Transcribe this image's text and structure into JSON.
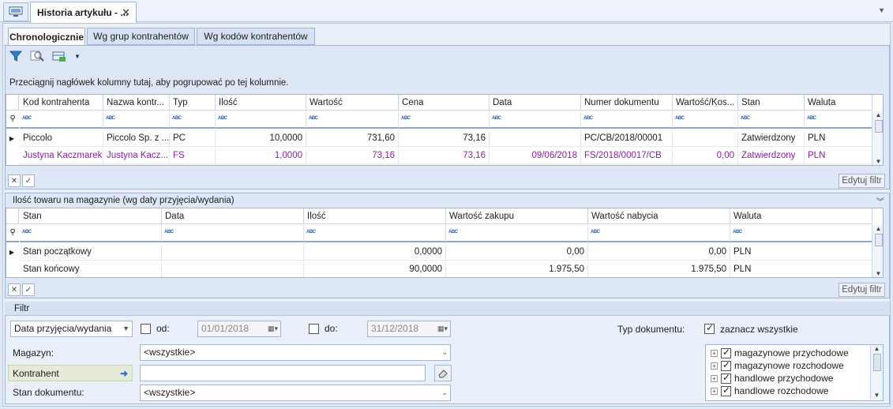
{
  "window": {
    "tab_title": "Historia artykułu - ...",
    "close": "✕",
    "menu_arrow": "▼"
  },
  "tabs": [
    {
      "label": "Chronologicznie"
    },
    {
      "label": "Wg grup kontrahentów"
    },
    {
      "label": "Wg kodów kontrahentów"
    }
  ],
  "group_hint": "Przeciągnij nagłówek kolumny tutaj, aby pogrupować po tej kolumnie.",
  "filter_row_marker": "ABC",
  "grid1": {
    "headers": [
      "Kod kontrahenta",
      "Nazwa kontr...",
      "Typ",
      "Ilość",
      "Wartość",
      "Cena",
      "Data",
      "Numer dokumentu",
      "Wartość/Kos...",
      "Stan",
      "Waluta"
    ],
    "rows": [
      [
        "Piccolo",
        "Piccolo Sp. z ...",
        "PC",
        "10,0000",
        "731,60",
        "73,16",
        "",
        "PC/CB/2018/00001",
        "",
        "Zatwierdzony",
        "PLN"
      ],
      [
        "Justyna Kaczmarek",
        "Justyna Kacz...",
        "FS",
        "1,0000",
        "73,16",
        "73,16",
        "09/06/2018",
        "FS/2018/00017/CB",
        "0,00",
        "Zatwierdzony",
        "PLN"
      ]
    ],
    "edit_filter": "Edytuj filtr"
  },
  "section2_title": "Ilość towaru na magazynie (wg daty przyjęcia/wydania)",
  "grid2": {
    "headers": [
      "Stan",
      "Data",
      "Ilość",
      "Wartość zakupu",
      "Wartość nabycia",
      "Waluta"
    ],
    "rows": [
      [
        "Stan początkowy",
        "",
        "0,0000",
        "0,00",
        "0,00",
        "PLN"
      ],
      [
        "Stan końcowy",
        "",
        "90,0000",
        "1.975,50",
        "1.975,50",
        "PLN"
      ]
    ],
    "edit_filter": "Edytuj filtr"
  },
  "filter": {
    "title": "Filtr",
    "date_type": "Data przyjęcia/wydania",
    "from_label": "od:",
    "from_value": "01/01/2018",
    "to_label": "do:",
    "to_value": "31/12/2018",
    "warehouse_label": "Magazyn:",
    "warehouse_value": "<wszystkie>",
    "contractor_label": "Kontrahent",
    "contractor_value": "",
    "status_label": "Stan dokumentu:",
    "status_value": "<wszystkie>",
    "doctype_label": "Typ dokumentu:",
    "select_all": "zaznacz wszystkie",
    "doc_types": [
      "magazynowe przychodowe",
      "magazynowe rozchodowe",
      "handlowe przychodowe",
      "handlowe rozchodowe"
    ]
  },
  "colors": {
    "accent": "#2a5caa",
    "highlight_row": "#8a1fa5",
    "panel": "#dde7f5"
  }
}
